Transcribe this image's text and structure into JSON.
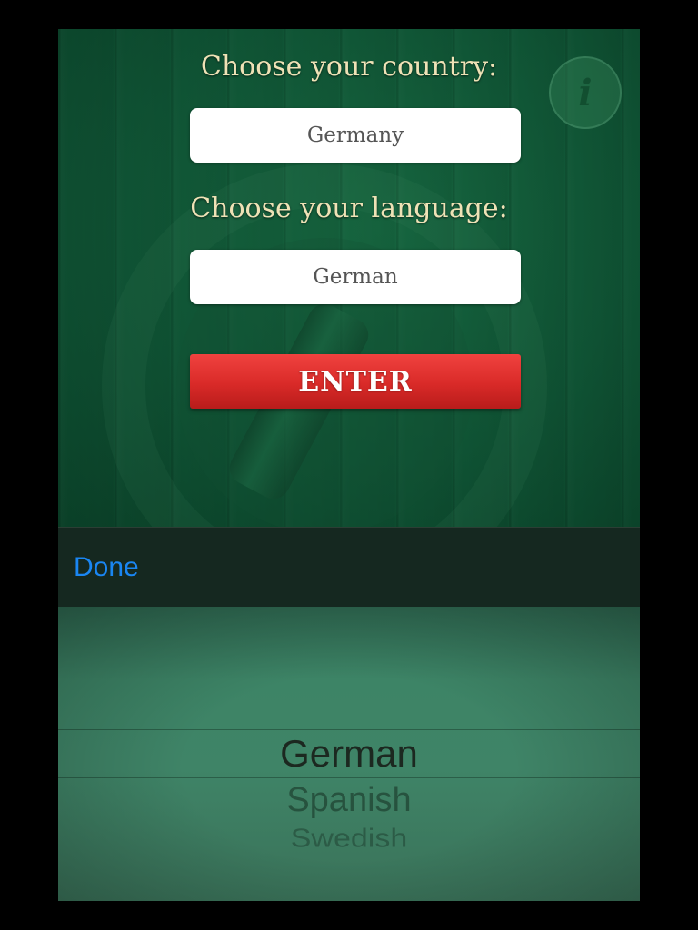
{
  "country": {
    "label": "Choose your country:",
    "value": "Germany"
  },
  "language": {
    "label": "Choose your language:",
    "value": "German"
  },
  "enter_button": {
    "label": "ENTER"
  },
  "info_button": {
    "icon": "info-icon",
    "glyph": "i"
  },
  "toolbar": {
    "done_label": "Done"
  },
  "picker": {
    "options": [
      "German",
      "Spanish",
      "Swedish"
    ],
    "selected": "German"
  },
  "colors": {
    "accent_red": "#d92a28",
    "done_blue": "#1a86f2",
    "label_cream": "#efe2b6",
    "background_green": "#0f5334"
  }
}
